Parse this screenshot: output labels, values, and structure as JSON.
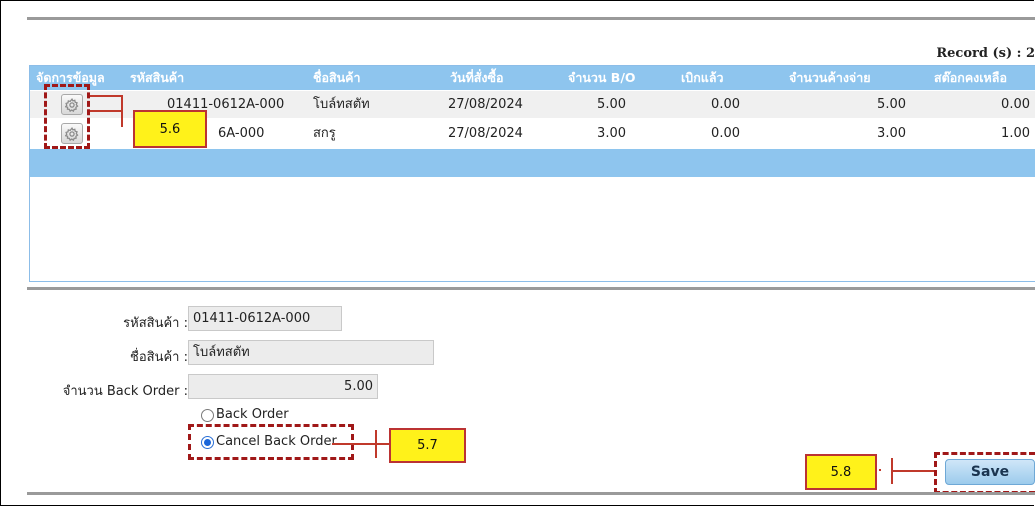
{
  "record_label": "Record (s) : 2",
  "grid": {
    "headers": [
      "จัดการข้อมูล",
      "รหัสสินค้า",
      "ชื่อสินค้า",
      "วันที่สั่งซื้อ",
      "จำนวน B/O",
      "เบิกแล้ว",
      "จำนวนค้างจ่าย",
      "สต๊อกคงเหลือ"
    ],
    "rows": [
      {
        "code": "01411-0612A-000",
        "name": "โบล์ทสตัท",
        "date": "27/08/2024",
        "bo": "5.00",
        "withdrawn": "0.00",
        "pending": "5.00",
        "stock": "0.00"
      },
      {
        "code": "6A-000",
        "name": "สกรู",
        "date": "27/08/2024",
        "bo": "3.00",
        "withdrawn": "0.00",
        "pending": "3.00",
        "stock": "1.00"
      }
    ]
  },
  "form": {
    "code_label": "รหัสสินค้า :",
    "code_value": "01411-0612A-000",
    "name_label": "ชื่อสินค้า :",
    "name_value": "โบล์ทสตัท",
    "qty_label": "จำนวน Back Order :",
    "qty_value": "5.00",
    "radio_back_order": "Back Order",
    "radio_cancel": "Cancel Back Order",
    "selected": "Cancel Back Order"
  },
  "save_label": "Save",
  "callouts": {
    "c56": "5.6",
    "c57": "5.7",
    "c58": "5.8"
  },
  "colors": {
    "header_bg": "#8ec5ee",
    "callout_bg": "#fff21a",
    "dash": "#a01818",
    "radio_selected": "#1a66d9"
  },
  "icons": {
    "row_action": "gear-icon"
  }
}
